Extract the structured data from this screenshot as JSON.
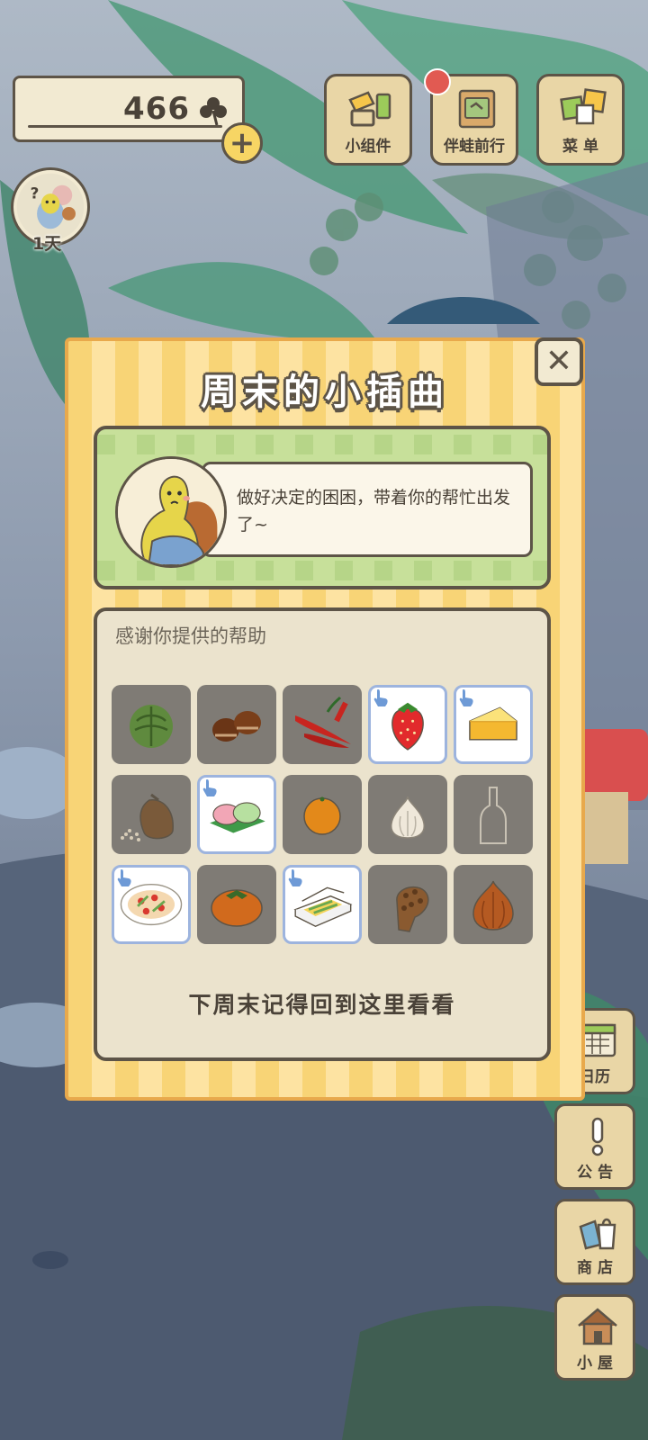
{
  "hud": {
    "clover_count": "466",
    "clover_icon": "clover-icon",
    "plus_icon": "+",
    "days_label": "1天"
  },
  "top_menu": {
    "widgets_label": "小组件",
    "travel_label": "伴蛙前行",
    "menu_label": "菜 单",
    "travel_has_notification": true
  },
  "side_menu": {
    "calendar_label": "日历",
    "notice_label": "公 告",
    "shop_label": "商 店",
    "house_label": "小 屋"
  },
  "dialog": {
    "title": "周末的小插曲",
    "close_glyph": "✕",
    "speech": "做好决定的困困，带着你的帮忙出发了~",
    "thanks_title": "感谢你提供的帮助",
    "footer": "下周末记得回到这里看看",
    "items": [
      {
        "icon": "cabbage-icon",
        "selected": false
      },
      {
        "icon": "chestnuts-icon",
        "selected": false
      },
      {
        "icon": "chili-peppers-icon",
        "selected": false
      },
      {
        "icon": "strawberry-icon",
        "selected": true
      },
      {
        "icon": "cheese-icon",
        "selected": true
      },
      {
        "icon": "rice-sack-icon",
        "selected": false
      },
      {
        "icon": "mochi-icon",
        "selected": true
      },
      {
        "icon": "orange-icon",
        "selected": false
      },
      {
        "icon": "garlic-icon",
        "selected": false
      },
      {
        "icon": "bottle-icon",
        "selected": false
      },
      {
        "icon": "pizza-plate-icon",
        "selected": true
      },
      {
        "icon": "persimmon-icon",
        "selected": false
      },
      {
        "icon": "bento-box-icon",
        "selected": true
      },
      {
        "icon": "pinecone-icon",
        "selected": false
      },
      {
        "icon": "onion-icon",
        "selected": false
      }
    ]
  },
  "colors": {
    "outline": "#5d5447",
    "dialog_stripe_a": "#f8d476",
    "dialog_stripe_b": "#fde3a2",
    "speech_bg": "#c7e09a",
    "selected_border": "#9db4de",
    "notification": "#e15a52"
  }
}
